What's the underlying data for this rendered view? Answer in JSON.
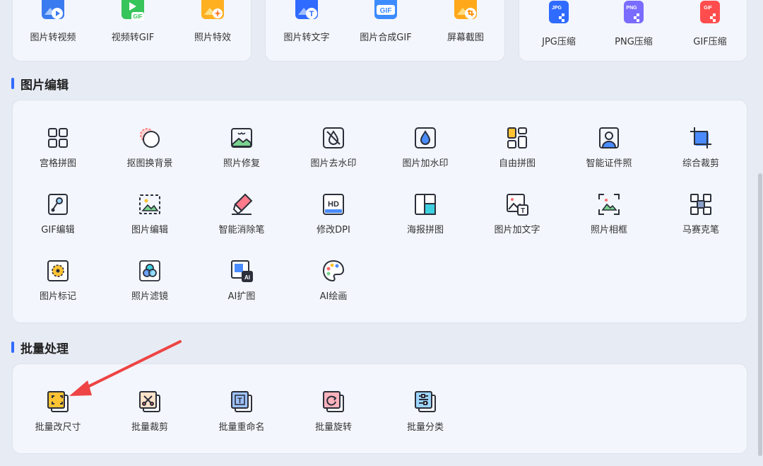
{
  "top_groups": [
    [
      "图片转视频",
      "视频转GIF",
      "照片特效"
    ],
    [
      "图片转文字",
      "图片合成GIF",
      "屏幕截图"
    ],
    [
      "JPG压缩",
      "PNG压缩",
      "GIF压缩"
    ]
  ],
  "top_badges": {
    "gif": "GIF",
    "jpg": "JPG",
    "png": "PNG"
  },
  "sections": {
    "image_edit": {
      "title": "图片编辑",
      "tools": [
        "宫格拼图",
        "抠图换背景",
        "照片修复",
        "图片去水印",
        "图片加水印",
        "自由拼图",
        "智能证件照",
        "综合裁剪",
        "GIF编辑",
        "图片编辑",
        "智能消除笔",
        "修改DPI",
        "海报拼图",
        "图片加文字",
        "照片相框",
        "马赛克笔",
        "图片标记",
        "照片滤镜",
        "AI扩图",
        "AI绘画"
      ]
    },
    "batch": {
      "title": "批量处理",
      "tools": [
        "批量改尺寸",
        "批量裁剪",
        "批量重命名",
        "批量旋转",
        "批量分类"
      ]
    }
  },
  "icon_text": {
    "hd": "HD",
    "ai": "AI",
    "t": "T"
  },
  "colors": {
    "accent": "#2f6bff",
    "arrow": "#ee4444",
    "icon_stroke": "#2b2f3a",
    "icon_fill": "#4a8cff"
  }
}
